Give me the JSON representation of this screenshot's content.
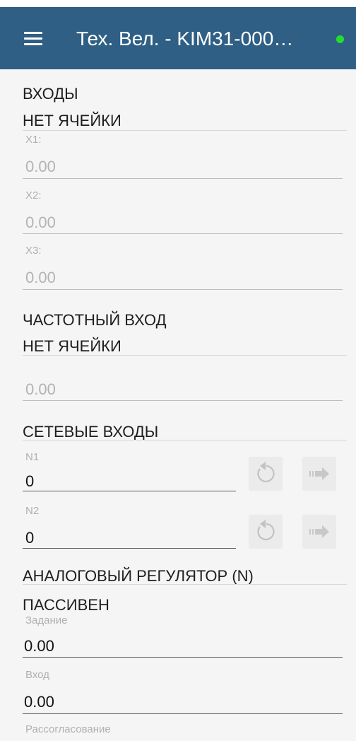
{
  "header": {
    "title": "Тех. Вел. - KIM31-000…",
    "menu_icon": "menu-icon",
    "status_dot_color": "#22e02a",
    "bar_color": "#2f5f84"
  },
  "inputs": {
    "title": "ВХОДЫ",
    "cell_status": "НЕТ ЯЧЕЙКИ",
    "fields": [
      {
        "label": "X1:",
        "value": "0.00"
      },
      {
        "label": "X2:",
        "value": "0.00"
      },
      {
        "label": "X3:",
        "value": "0.00"
      }
    ]
  },
  "freq_input": {
    "title": "ЧАСТОТНЫЙ ВХОД",
    "cell_status": "НЕТ ЯЧЕЙКИ",
    "value": "0.00"
  },
  "network_inputs": {
    "title": "СЕТЕВЫЕ ВХОДЫ",
    "fields": [
      {
        "label": "N1",
        "value": "0",
        "reset_icon": "reset-icon",
        "send_icon": "send-arrow-icon"
      },
      {
        "label": "N2",
        "value": "0",
        "reset_icon": "reset-icon",
        "send_icon": "send-arrow-icon"
      }
    ]
  },
  "analog_regulator": {
    "title": "АНАЛОГОВЫЙ РЕГУЛЯТОР (N)",
    "state": "ПАССИВЕН",
    "fields": [
      {
        "label": "Задание",
        "value": "0.00"
      },
      {
        "label": "Вход",
        "value": "0.00"
      },
      {
        "label": "Рассогласование",
        "value": ""
      }
    ]
  }
}
